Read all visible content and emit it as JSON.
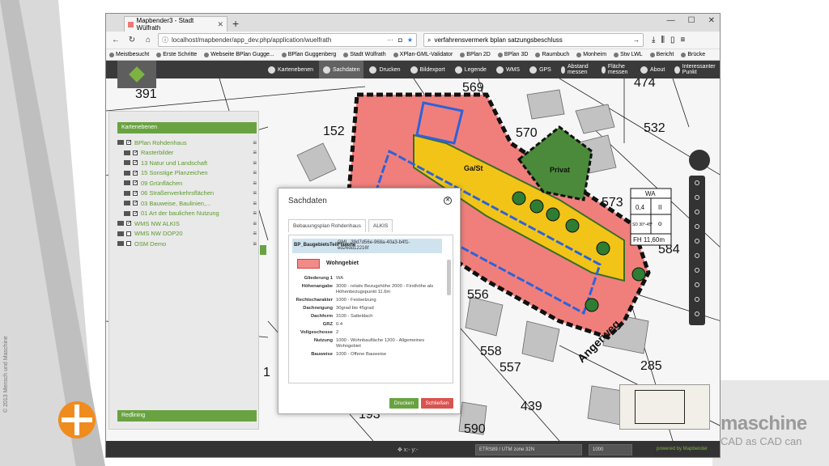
{
  "slide": {
    "copyright": "© 2013 Mensch und Maschine",
    "brand_main": "maschine",
    "brand_sub": "CAD as CAD can"
  },
  "browser": {
    "tab_title": "Mapbender3 - Stadt Wülfrath",
    "url": "localhost/mapbender/app_dev.php/application/wuelfrath",
    "search": "verfahrensvermerk bplan satzungsbeschluss",
    "bookmarks": [
      "Meistbesucht",
      "Erste Schritte",
      "Webseite BPlan Gugge...",
      "BPlan Guggenberg",
      "Stadt Wülfrath",
      "XPlan-GML-Validator",
      "BPlan 2D",
      "BPlan 3D",
      "Raumbuch",
      "Monheim",
      "Stw LWL",
      "Bericht",
      "Brücke"
    ]
  },
  "toolbar": {
    "items": [
      "Kartenebenen",
      "Sachdaten",
      "Drucken",
      "Bildexport",
      "Legende",
      "WMS",
      "GPS",
      "Abstand messen",
      "Fläche messen",
      "About",
      "Interessanter Punkt"
    ]
  },
  "layers": {
    "title": "Kartenebenen",
    "items": [
      {
        "label": "BPlan Rohdenhaus",
        "checked": true,
        "indent": 0
      },
      {
        "label": "Rasterbilder",
        "checked": true,
        "indent": 1
      },
      {
        "label": "13 Natur und Landschaft",
        "checked": true,
        "indent": 1
      },
      {
        "label": "15 Sonstige Planzeichen",
        "checked": true,
        "indent": 1
      },
      {
        "label": "09 Grünflächen",
        "checked": true,
        "indent": 1
      },
      {
        "label": "06 Straßenverkehrsflächen",
        "checked": true,
        "indent": 1
      },
      {
        "label": "03 Bauweise, Baulinien,...",
        "checked": true,
        "indent": 1
      },
      {
        "label": "01 Art der baulichen Nutzung",
        "checked": true,
        "indent": 1
      },
      {
        "label": "WMS NW ALKIS",
        "checked": true,
        "indent": 0
      },
      {
        "label": "WMS NW DOP20",
        "checked": false,
        "indent": 0
      },
      {
        "label": "OSM Demo",
        "checked": false,
        "indent": 0
      }
    ],
    "redlining": "Redlining"
  },
  "dialog": {
    "title": "Sachdaten",
    "tabs": [
      "Bebauungsplan Rohdenhaus",
      "ALKIS"
    ],
    "feature_key": "BP_BaugebietsTeilFlaeche",
    "feature_id": "GML_39d7d56e-968a-40a3-b4f1-ed26dd12216f",
    "swatch_label": "Wohngebiet",
    "attributes": [
      {
        "k": "Gliederung 1",
        "v": "WA"
      },
      {
        "k": "Höhenangabe",
        "v": "3000 - relativ Bezugshöhe 2000 - Firsthöhe als Höhenbezugspunkt 11.6m"
      },
      {
        "k": "Rechtscharakter",
        "v": "1000 - Festsetzung"
      },
      {
        "k": "Dachneigung",
        "v": "30grad bis 45grad"
      },
      {
        "k": "Dachform",
        "v": "3100 - Satteldach"
      },
      {
        "k": "GRZ",
        "v": "0.4"
      },
      {
        "k": "Vollgeschosse",
        "v": "2"
      },
      {
        "k": "Nutzung",
        "v": "1000 - Wohnbaufläche 1200 - Allgemeines Wohngebiet"
      },
      {
        "k": "Bauweise",
        "v": "1000 - Offene Bauweise"
      }
    ],
    "ok": "Drucken",
    "cancel": "Schließen"
  },
  "map": {
    "parcel_numbers": [
      "391",
      "152",
      "569",
      "570",
      "474",
      "532",
      "573",
      "584",
      "556",
      "558",
      "557",
      "285",
      "439",
      "193",
      "590",
      "1"
    ],
    "labels": {
      "garage": "Ga/St",
      "private": "Privat",
      "street": "Angerweg"
    },
    "table": {
      "title": "WA",
      "c1": "0,4",
      "c2": "II",
      "c3": "SD 30°-45°",
      "c4": "o",
      "fh": "FH 11,60m"
    }
  },
  "statusbar": {
    "srs": "ETRS89 / UTM zone 32N",
    "scale": "1000",
    "powered": "powered by Mapbender"
  }
}
